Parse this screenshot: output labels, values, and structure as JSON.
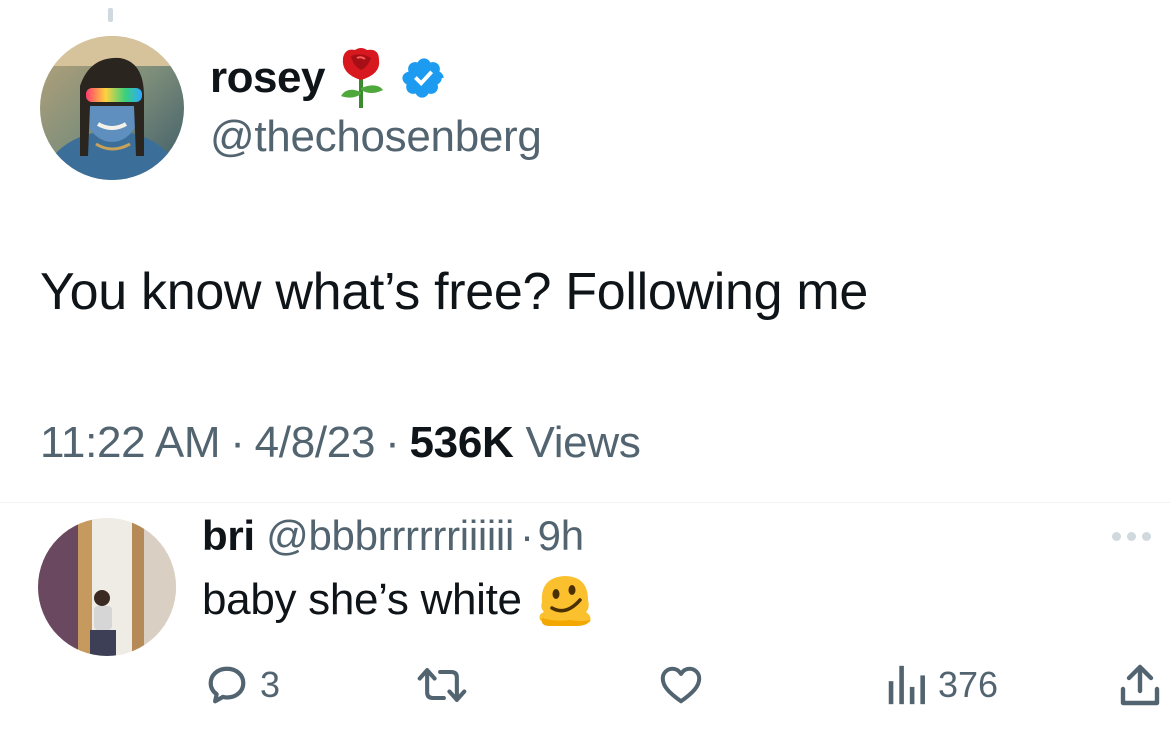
{
  "tweet": {
    "author": {
      "display_name": "rosey",
      "handle": "@thechosenberg",
      "badge_icon": "rose-emoji-icon",
      "verified_icon": "verified-badge-icon",
      "verified_color": "#1d9bf0"
    },
    "text": "You know what’s free? Following me",
    "time": "11:22 AM",
    "date": "4/8/23",
    "views_count": "536K",
    "views_label": "Views",
    "separator": "·"
  },
  "reply": {
    "display_name": "bri",
    "handle": "@bbbrrrrrriiiiii",
    "separator": "·",
    "time": "9h",
    "text": "baby she’s white",
    "emoji_icon": "melting-face-emoji-icon",
    "actions": {
      "reply_count": "3",
      "retweet_count": "",
      "like_count": "",
      "views_count": "376"
    }
  },
  "colors": {
    "text_primary": "#0f1419",
    "text_secondary": "#536471",
    "divider": "#eff3f4"
  }
}
